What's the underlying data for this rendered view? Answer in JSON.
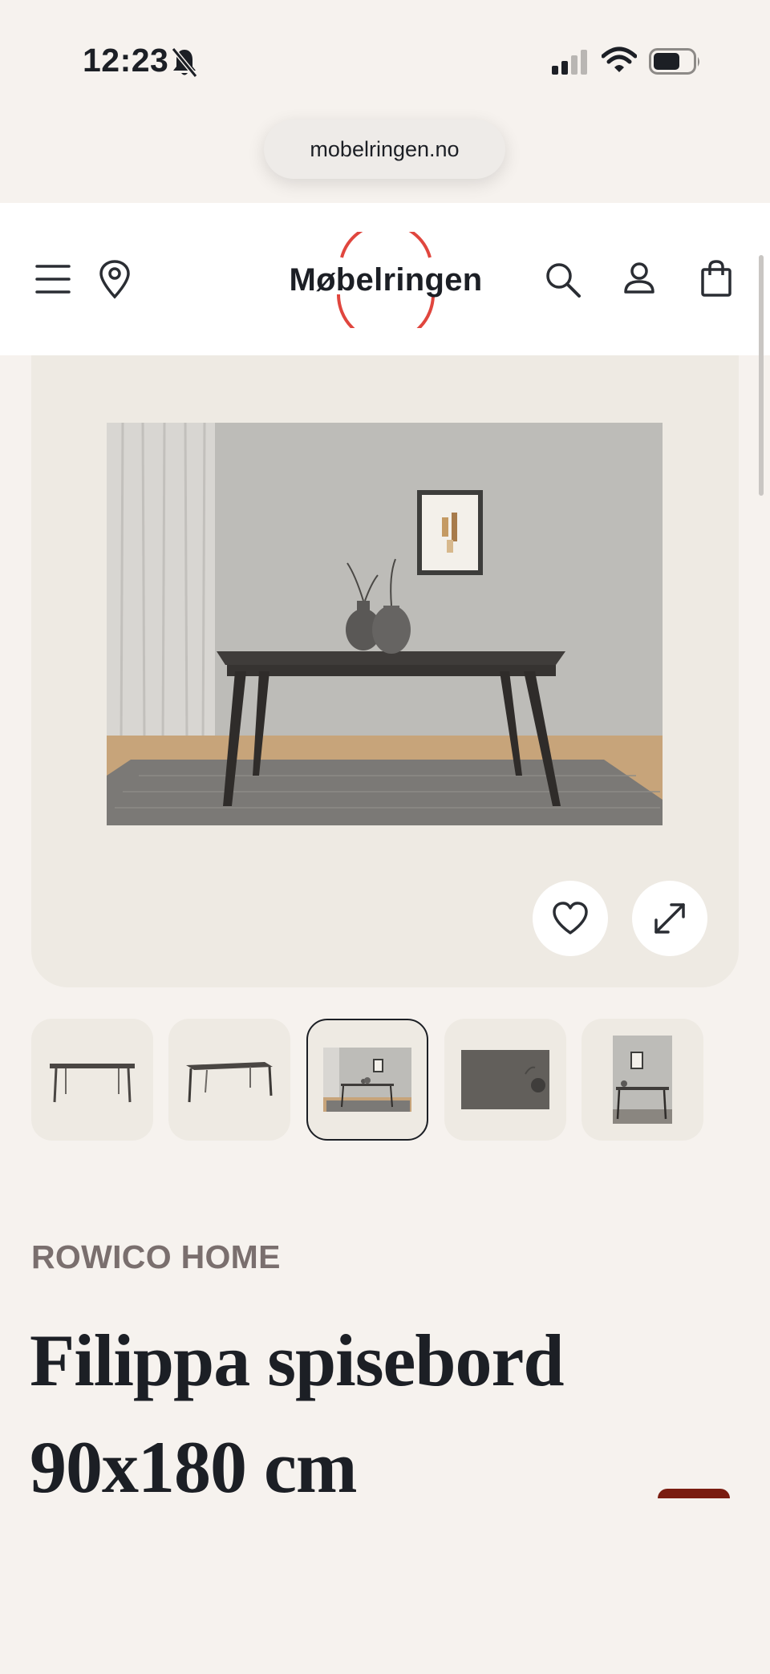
{
  "status_bar": {
    "time": "12:23",
    "icons": [
      "bell-slash-icon",
      "cellular-signal-icon",
      "wifi-icon",
      "battery-icon"
    ]
  },
  "browser": {
    "url": "mobelringen.no"
  },
  "header": {
    "logo_text": "Møbelringen",
    "icons": [
      "menu-icon",
      "location-pin-icon",
      "search-icon",
      "account-icon",
      "shopping-bag-icon"
    ]
  },
  "gallery": {
    "main_image": "dark dining table in room with vases, framed art, curtain and rug",
    "favorite_icon": "heart-icon",
    "expand_icon": "expand-arrows-icon",
    "thumbnails": [
      {
        "label": "table-front-view",
        "active": false
      },
      {
        "label": "table-angle-view",
        "active": false
      },
      {
        "label": "table-room-scene",
        "active": true
      },
      {
        "label": "table-top-detail",
        "active": false
      },
      {
        "label": "table-portrait-scene",
        "active": false
      }
    ]
  },
  "product": {
    "brand": "ROWICO HOME",
    "title": "Filippa spisebord 90x180 cm"
  },
  "colors": {
    "page_bg": "#f6f2ee",
    "gallery_bg": "#eeeae3",
    "logo_ring": "#e0463e",
    "brand_text": "#7a6f6e",
    "title_text": "#1c1f25"
  }
}
